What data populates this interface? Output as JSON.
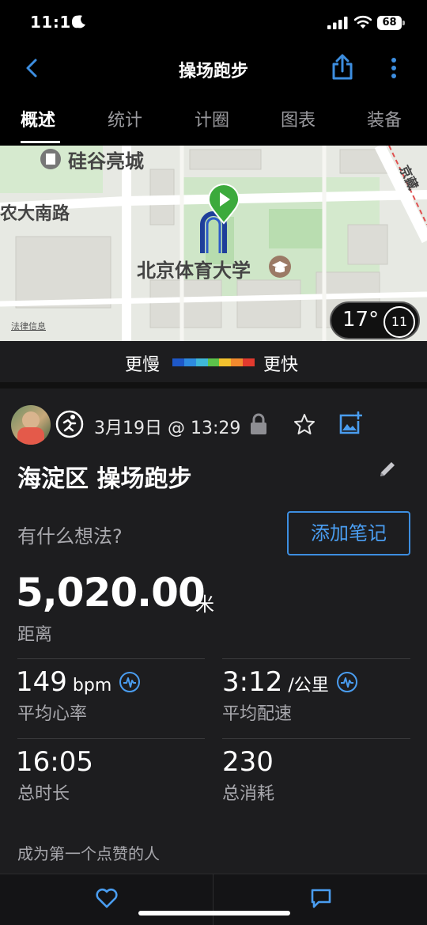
{
  "status_bar": {
    "time": "11:16",
    "battery": "68"
  },
  "nav": {
    "title": "操场跑步"
  },
  "tabs": [
    {
      "label": "概述",
      "active": true
    },
    {
      "label": "统计",
      "active": false
    },
    {
      "label": "计圈",
      "active": false
    },
    {
      "label": "图表",
      "active": false
    },
    {
      "label": "装备",
      "active": false
    }
  ],
  "map": {
    "labels": {
      "mall": "硅谷亮城",
      "road": "农大南路",
      "university": "北京体育大学",
      "side_road": "京藏",
      "legal": "法律信息"
    },
    "weather": {
      "temperature": "17°",
      "wind_speed": "11"
    }
  },
  "pace_legend": {
    "slow_label": "更慢",
    "fast_label": "更快",
    "colors": [
      "#1e58c8",
      "#2e8be0",
      "#3fb8d8",
      "#5cc24a",
      "#f2c12e",
      "#f28a2e",
      "#e23a2e"
    ]
  },
  "activity": {
    "date": "3月19日 @ 13:29",
    "title": "海淀区 操场跑步",
    "notes_prompt": "有什么想法?",
    "add_note_label": "添加笔记"
  },
  "distance": {
    "value": "5,020.00",
    "unit": "米",
    "label": "距离"
  },
  "stats": {
    "heart_rate": {
      "value": "149",
      "unit": " bpm",
      "label": "平均心率"
    },
    "pace": {
      "value": "3:12",
      "unit": " /公里",
      "label": "平均配速"
    },
    "duration": {
      "value": "16:05",
      "label": "总时长"
    },
    "calories": {
      "value": "230",
      "label": "总消耗"
    }
  },
  "likes_text": "成为第一个点赞的人",
  "colors": {
    "accent": "#4a9df0",
    "background": "#1d1d1f",
    "route": "#1f3f9a"
  }
}
